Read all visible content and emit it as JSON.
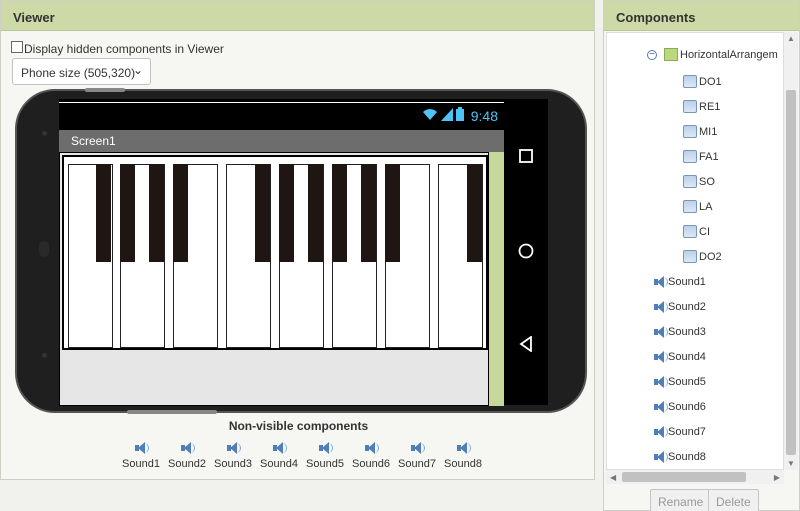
{
  "viewer": {
    "title": "Viewer",
    "hidden_label": "Display hidden components in Viewer",
    "size_select": "Phone size (505,320)",
    "status_time": "9:48",
    "screen_title": "Screen1",
    "nonvisible_title": "Non-visible components",
    "sounds": [
      "Sound1",
      "Sound2",
      "Sound3",
      "Sound4",
      "Sound5",
      "Sound6",
      "Sound7",
      "Sound8"
    ]
  },
  "components": {
    "title": "Components",
    "arrangement": "HorizontalArrangem",
    "keys": [
      "DO1",
      "RE1",
      "MI1",
      "FA1",
      "SO",
      "LA",
      "CI",
      "DO2"
    ],
    "sounds": [
      "Sound1",
      "Sound2",
      "Sound3",
      "Sound4",
      "Sound5",
      "Sound6",
      "Sound7",
      "Sound8"
    ],
    "rename": "Rename",
    "delete": "Delete"
  },
  "colors": {
    "header": "#cdd9a6",
    "accent": "#4fc3f7",
    "scroll": "#c7d99a"
  }
}
